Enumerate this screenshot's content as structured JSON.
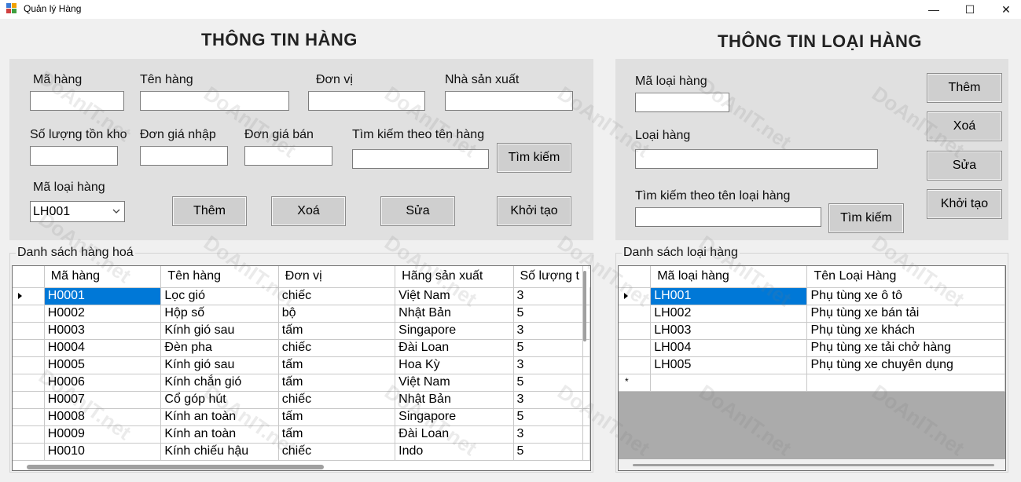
{
  "window": {
    "title": "Quản lý Hàng",
    "minimize": "—",
    "maximize": "☐",
    "close": "✕"
  },
  "left": {
    "heading": "THÔNG TIN HÀNG",
    "labels": {
      "ma_hang": "Mã hàng",
      "ten_hang": "Tên hàng",
      "don_vi": "Đơn vị",
      "nha_san_xuat": "Nhà sản xuất",
      "so_luong_ton_kho": "Số lượng tồn kho",
      "don_gia_nhap": "Đơn giá nhập",
      "don_gia_ban": "Đơn giá bán",
      "tim_kiem_theo_ten_hang": "Tìm kiếm theo tên hàng",
      "ma_loai_hang": "Mã loại hàng"
    },
    "inputs": {
      "ma_hang": "",
      "ten_hang": "",
      "don_vi": "",
      "nha_san_xuat": "",
      "so_luong_ton_kho": "",
      "don_gia_nhap": "",
      "don_gia_ban": "",
      "tim_kiem": ""
    },
    "ma_loai_hang_selected": "LH001",
    "buttons": {
      "tim_kiem": "Tìm kiếm",
      "them": "Thêm",
      "xoa": "Xoá",
      "sua": "Sửa",
      "khoi_tao": "Khởi tạo"
    },
    "list_title": "Danh sách hàng hoá",
    "columns": [
      "Mã hàng",
      "Tên hàng",
      "Đơn vị",
      "Hãng sản xuất",
      "Số lượng t"
    ],
    "rows": [
      [
        "H0001",
        "Lọc gió",
        "chiếc",
        "Việt Nam",
        "3"
      ],
      [
        "H0002",
        "Hộp số",
        "bộ",
        "Nhật Bản",
        "5"
      ],
      [
        "H0003",
        "Kính gió sau",
        "tấm",
        "Singapore",
        "3"
      ],
      [
        "H0004",
        "Đèn pha",
        "chiếc",
        "Đài Loan",
        "5"
      ],
      [
        "H0005",
        "Kính gió sau",
        "tấm",
        "Hoa Kỳ",
        "3"
      ],
      [
        "H0006",
        "Kính chắn gió",
        "tấm",
        "Việt Nam",
        "5"
      ],
      [
        "H0007",
        "Cổ góp hút",
        "chiếc",
        "Nhật Bản",
        "3"
      ],
      [
        "H0008",
        "Kính an toàn",
        "tấm",
        "Singapore",
        "5"
      ],
      [
        "H0009",
        "Kính an toàn",
        "tấm",
        "Đài Loan",
        "3"
      ],
      [
        "H0010",
        "Kính chiếu hậu",
        "chiếc",
        "Indo",
        "5"
      ]
    ]
  },
  "right": {
    "heading": "THÔNG TIN LOẠI HÀNG",
    "labels": {
      "ma_loai_hang": "Mã loại hàng",
      "loai_hang": "Loại hàng",
      "tim_kiem_theo_ten_loai_hang": "Tìm kiếm theo tên loại hàng"
    },
    "inputs": {
      "ma_loai_hang": "",
      "loai_hang": "",
      "tim_kiem": ""
    },
    "buttons": {
      "them": "Thêm",
      "xoa": "Xoá",
      "sua": "Sửa",
      "khoi_tao": "Khởi tạo",
      "tim_kiem": "Tìm kiếm"
    },
    "list_title": "Danh sách loại hàng",
    "columns": [
      "Mã loại hàng",
      "Tên Loại Hàng"
    ],
    "rows": [
      [
        "LH001",
        "Phụ tùng xe ô tô"
      ],
      [
        "LH002",
        "Phụ tùng xe bán tải"
      ],
      [
        "LH003",
        "Phụ tùng xe khách"
      ],
      [
        "LH004",
        "Phụ tùng xe tải chở hàng"
      ],
      [
        "LH005",
        "Phụ tùng xe chuyên dụng"
      ]
    ]
  },
  "watermark": "DoAnIT.net"
}
